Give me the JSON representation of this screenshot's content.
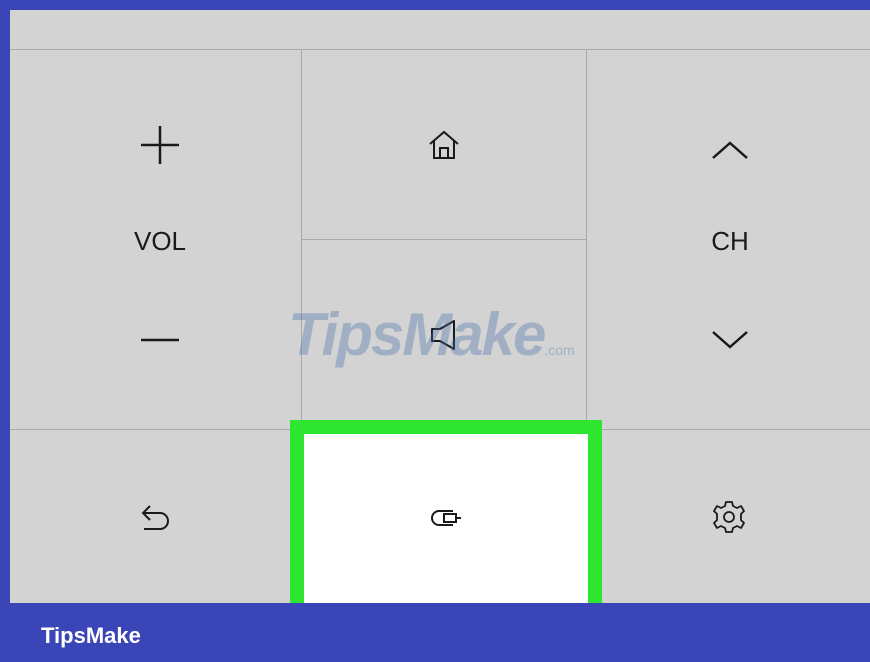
{
  "remote": {
    "volume": {
      "label": "VOL",
      "up_icon": "plus-icon",
      "down_icon": "minus-icon"
    },
    "channel": {
      "label": "CH",
      "up_icon": "chevron-up-icon",
      "down_icon": "chevron-down-icon"
    },
    "home_icon": "home-icon",
    "mute_icon": "speaker-mute-icon",
    "back_icon": "back-arrow-icon",
    "input_icon": "input-source-icon",
    "settings_icon": "gear-icon",
    "highlight_color": "#2ee630"
  },
  "watermark": {
    "main": "TipsMake",
    "suffix": ".com"
  },
  "footer": {
    "brand": "TipsMake",
    "background": "#3a46b8"
  }
}
